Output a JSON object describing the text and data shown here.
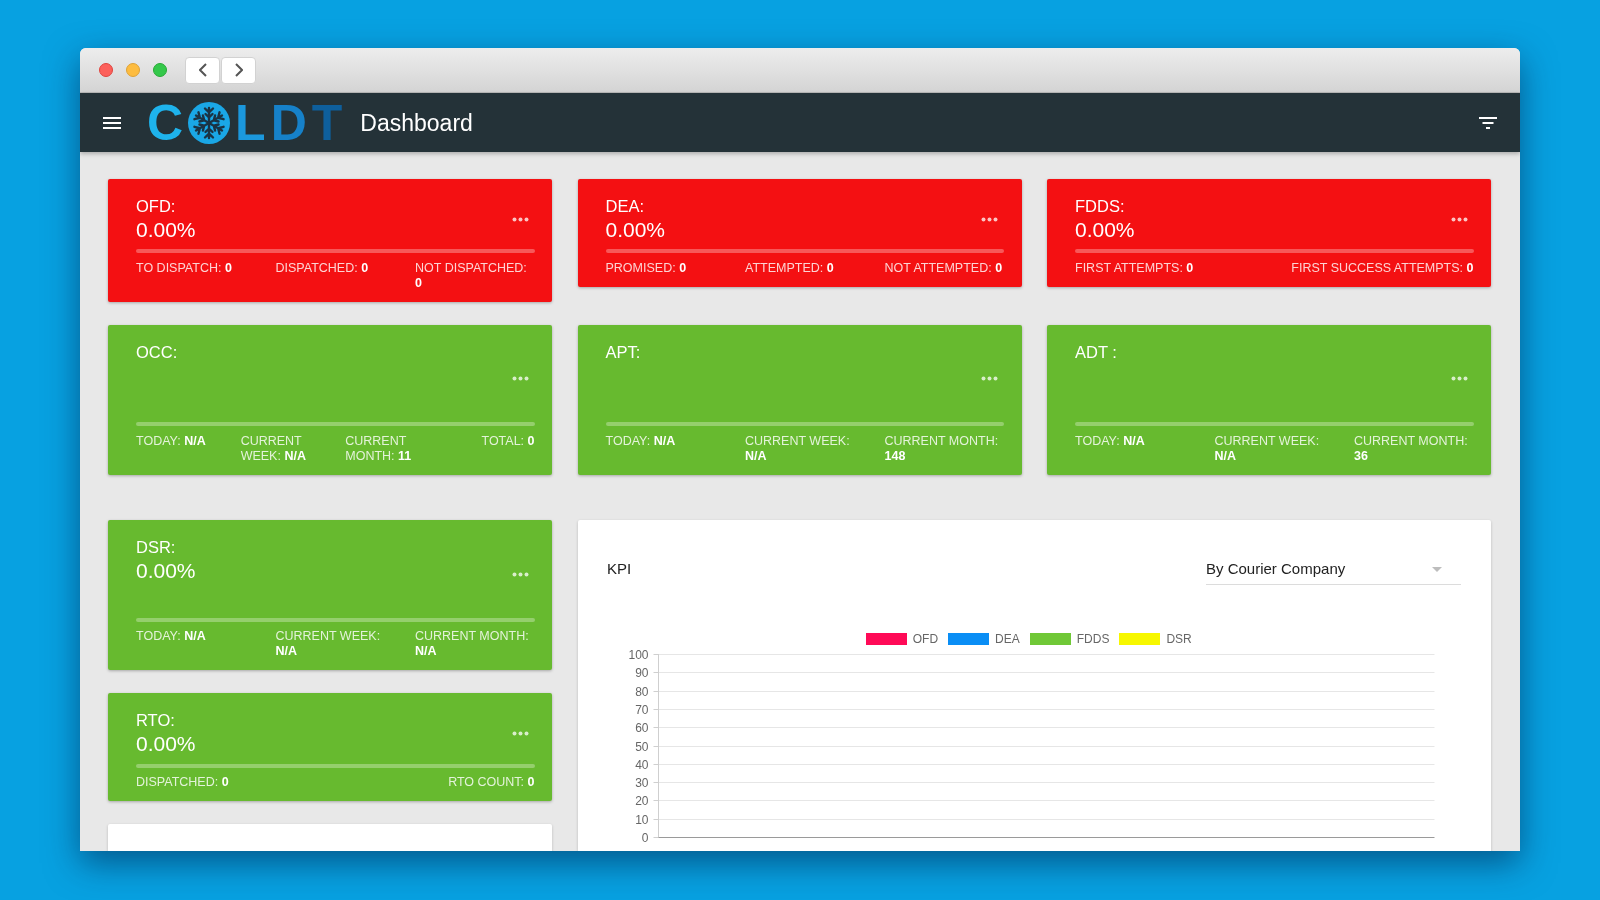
{
  "app_bar": {
    "logo": {
      "text_before_icon": "C",
      "text_after_icon": "LDT"
    },
    "title": "Dashboard"
  },
  "top_row": [
    {
      "title": "OFD:",
      "value": "0.00%",
      "color": "#f41012",
      "level": 0,
      "stats": [
        "TO DISPATCH: **0**",
        "DISPATCHED: **0**",
        "NOT DISPATCHED: **0**"
      ]
    },
    {
      "title": "DEA:",
      "value": "0.00%",
      "color": "#f41012",
      "level": 0,
      "stats": [
        "PROMISED: **0**",
        "ATTEMPTED: **0**",
        "NOT ATTEMPTED: **0**"
      ]
    },
    {
      "title": "FDDS:",
      "value": "0.00%",
      "color": "#f41012",
      "level": 0,
      "stats": [
        "FIRST ATTEMPTS: **0**",
        "FIRST SUCCESS ATTEMPTS: **0**"
      ]
    }
  ],
  "second_row": [
    {
      "title": "OCC:",
      "color": "#67ba2f",
      "level": 0,
      "stats": [
        "TODAY: **N/A**",
        "CURRENT WEEK: **N/A**",
        "CURRENT MONTH: **11**",
        "TOTAL: **0**"
      ]
    },
    {
      "title": "APT:",
      "color": "#67ba2f",
      "level": 0,
      "stats": [
        "TODAY: **N/A**",
        "CURRENT WEEK: **N/A**",
        "CURRENT MONTH: **148**"
      ]
    },
    {
      "title": "ADT :",
      "color": "#67ba2f",
      "level": 0,
      "stats": [
        "TODAY: **N/A**",
        "CURRENT WEEK: **N/A**",
        "CURRENT MONTH: **36**"
      ]
    }
  ],
  "left_column": [
    {
      "kind": "metric",
      "title": "DSR:",
      "value": "0.00%",
      "color": "#67ba2f",
      "level": 0,
      "stats": [
        "TODAY: **N/A**",
        "CURRENT WEEK: **N/A**",
        "CURRENT MONTH: **N/A**"
      ]
    },
    {
      "kind": "metric",
      "title": "RTO:",
      "value": "0.00%",
      "color": "#67ba2f",
      "level": 0,
      "stats": [
        "DISPATCHED: **0**",
        "RTO COUNT: **0**"
      ]
    },
    {
      "kind": "blank"
    }
  ],
  "kpi_panel": {
    "title": "KPI",
    "group_by": {
      "value": "By Courier Company"
    },
    "chart_data": {
      "type": "bar",
      "series": [
        {
          "name": "OFD",
          "color": "#ff0a57"
        },
        {
          "name": "DEA",
          "color": "#0a8ef5"
        },
        {
          "name": "FDDS",
          "color": "#70c837"
        },
        {
          "name": "DSR",
          "color": "#f7f700"
        }
      ],
      "ylim": [
        0,
        100
      ],
      "yticks": [
        0,
        10,
        20,
        30,
        40,
        50,
        60,
        70,
        80,
        90,
        100
      ],
      "grid": true
    }
  }
}
